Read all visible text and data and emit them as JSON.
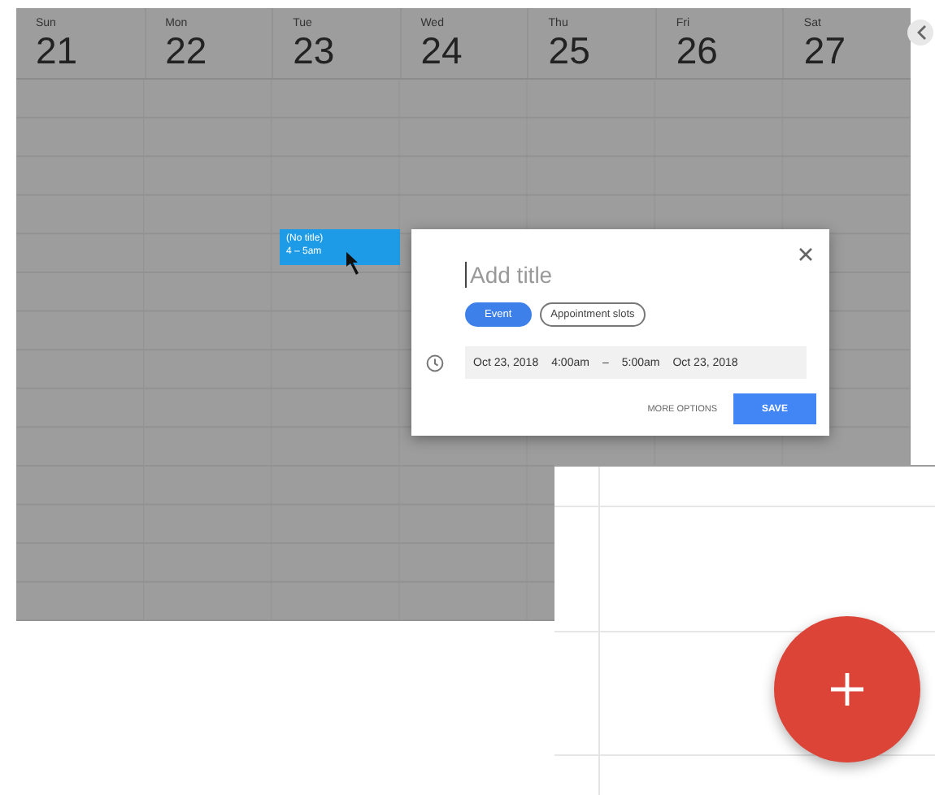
{
  "days": [
    {
      "weekday": "Sun",
      "date": "21"
    },
    {
      "weekday": "Mon",
      "date": "22"
    },
    {
      "weekday": "Tue",
      "date": "23"
    },
    {
      "weekday": "Wed",
      "date": "24"
    },
    {
      "weekday": "Thu",
      "date": "25"
    },
    {
      "weekday": "Fri",
      "date": "26"
    },
    {
      "weekday": "Sat",
      "date": "27"
    }
  ],
  "event": {
    "title": "(No title)",
    "time": "4 – 5am"
  },
  "dialog": {
    "title_placeholder": "Add title",
    "tabs": [
      {
        "label": "Event",
        "selected": true
      },
      {
        "label": "Appointment slots",
        "selected": false
      }
    ],
    "start_date": "Oct 23, 2018",
    "start_time": "4:00am",
    "separator": "–",
    "end_time": "5:00am",
    "end_date": "Oct 23, 2018",
    "more_options": "MORE OPTIONS",
    "save": "SAVE"
  }
}
